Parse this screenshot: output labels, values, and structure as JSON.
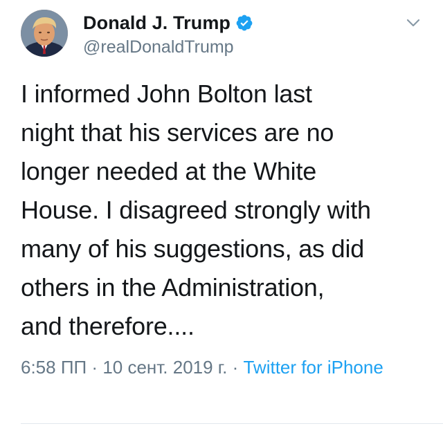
{
  "tweet": {
    "author": {
      "display_name": "Donald J. Trump",
      "handle": "@realDonaldTrump",
      "verified": true,
      "avatar_icon": "profile-photo"
    },
    "text": "I informed John Bolton last\nnight that his services are no\nlonger needed at the White\nHouse. I disagreed strongly with\nmany of his suggestions, as did\nothers in the Administration,\nand therefore....",
    "meta": {
      "time": "6:58 ПП",
      "separator": " · ",
      "date": "10 сент. 2019 г.",
      "separator2": " · ",
      "source": "Twitter for iPhone"
    },
    "menu_icon": "chevron-down-icon"
  },
  "colors": {
    "primary_text": "#14171a",
    "secondary_text": "#657786",
    "link": "#1da1f2",
    "verified_badge": "#1da1f2",
    "divider": "#e1e8ed"
  }
}
